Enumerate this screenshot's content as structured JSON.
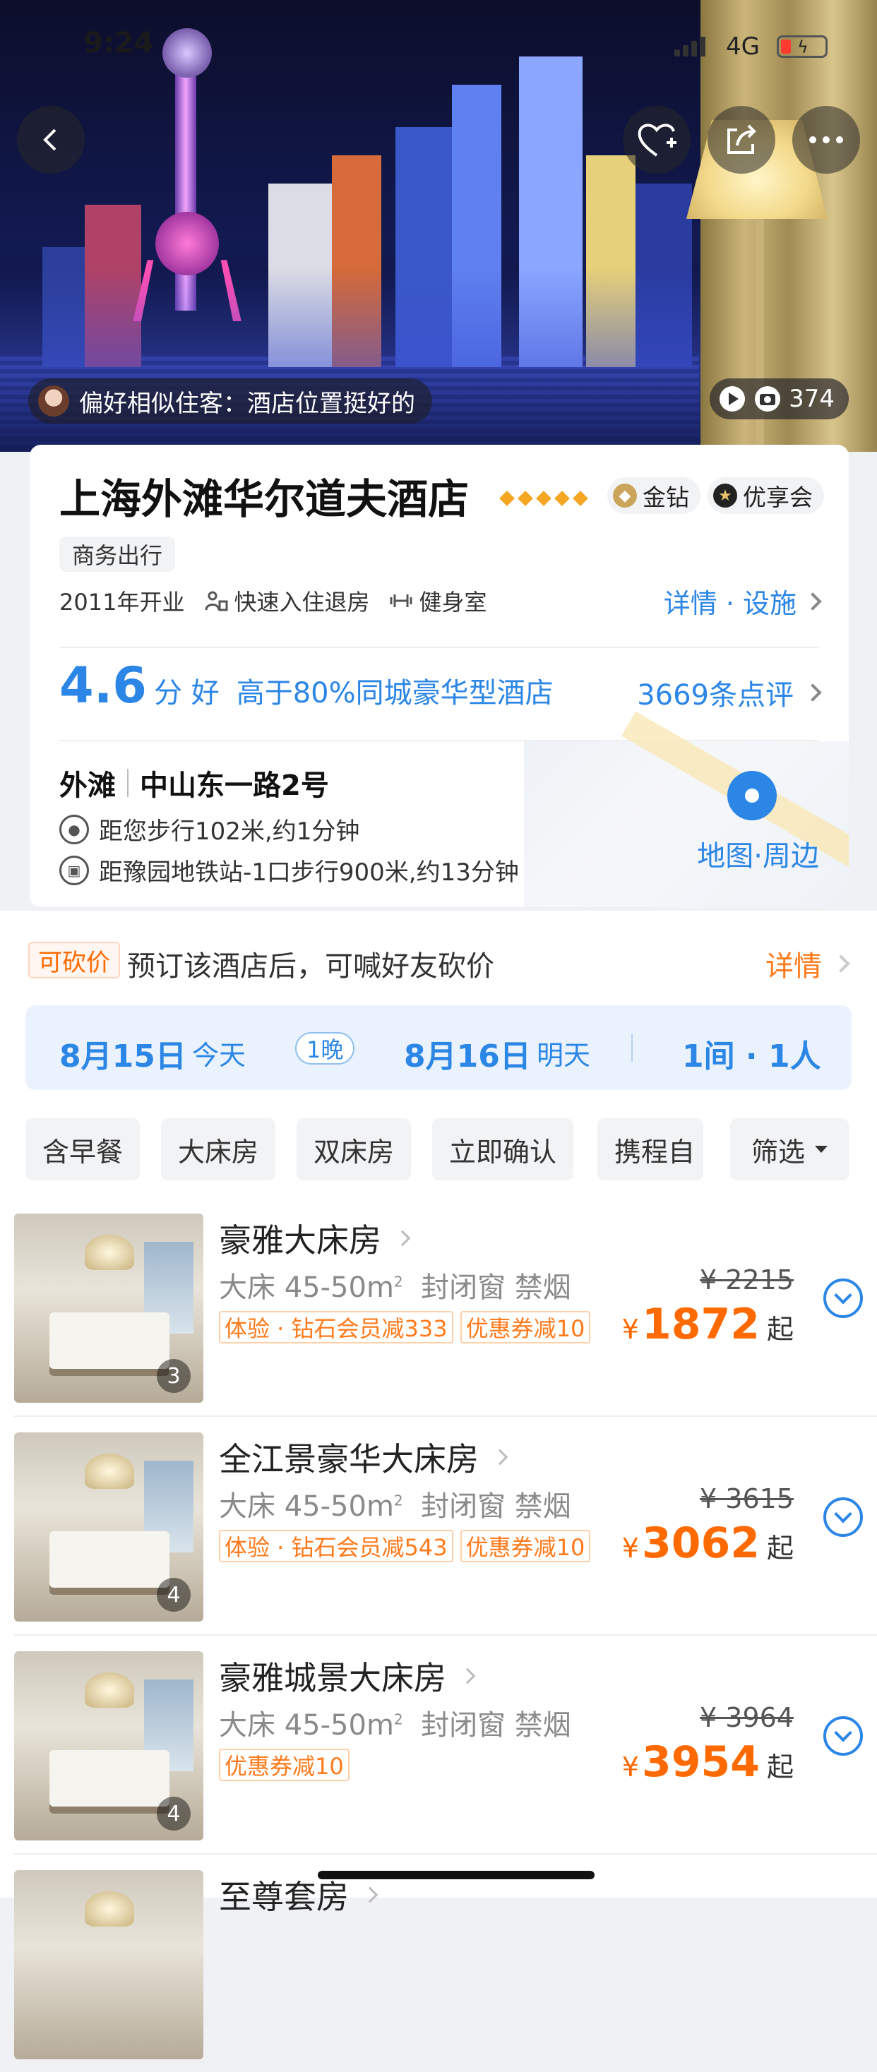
{
  "status_bar": {
    "time": "9:24",
    "network": "4G"
  },
  "hero": {
    "preference": "偏好相似住客：酒店位置挺好的",
    "media_count": "374"
  },
  "hotel": {
    "name": "上海外滩华尔道夫酒店",
    "star_count": 5,
    "badge_gold": "金钻",
    "badge_member": "优享会",
    "trip_tag": "商务出行",
    "opened": "2011年开业",
    "facility_1": "快速入住退房",
    "facility_2": "健身室",
    "detail_link": "详情 · 设施",
    "score": "4.6",
    "score_suffix": "分 好",
    "score_desc": "高于80%同城豪华型酒店",
    "reviews": "3669条点评",
    "area": "外滩",
    "address": "中山东一路2号",
    "walk": "距您步行102米,约1分钟",
    "metro": "距豫园地铁站-1口步行900米,约13分钟",
    "map_link": "地图·周边"
  },
  "bargain": {
    "tag": "可砍价",
    "text": "预订该酒店后，可喊好友砍价",
    "detail": "详情"
  },
  "dates": {
    "checkin": "8月15日",
    "checkin_sub": "今天",
    "nights": "1晚",
    "checkout": "8月16日",
    "checkout_sub": "明天",
    "rooms": "1间 · 1人"
  },
  "filters": [
    "含早餐",
    "大床房",
    "双床房",
    "立即确认",
    "携程自"
  ],
  "filter_button": "筛选",
  "rooms": [
    {
      "name": "豪雅大床房",
      "spec_a": "大床 45-50m",
      "spec_b": "封闭窗 禁烟",
      "tags": [
        "体验 · 钻石会员减333",
        "优惠券减10"
      ],
      "orig": "¥ 2215",
      "price": "1872",
      "qi": "起",
      "count": "3"
    },
    {
      "name": "全江景豪华大床房",
      "spec_a": "大床 45-50m",
      "spec_b": "封闭窗 禁烟",
      "tags": [
        "体验 · 钻石会员减543",
        "优惠券减10"
      ],
      "orig": "¥ 3615",
      "price": "3062",
      "qi": "起",
      "count": "4"
    },
    {
      "name": "豪雅城景大床房",
      "spec_a": "大床 45-50m",
      "spec_b": "封闭窗 禁烟",
      "tags": [
        "优惠券减10"
      ],
      "orig": "¥ 3964",
      "price": "3954",
      "qi": "起",
      "count": "4"
    },
    {
      "name": "至尊套房"
    }
  ],
  "currency": "¥",
  "colors": {
    "accent": "#2b86e6",
    "price": "#ff6a00",
    "diamond": "#f5a623"
  }
}
